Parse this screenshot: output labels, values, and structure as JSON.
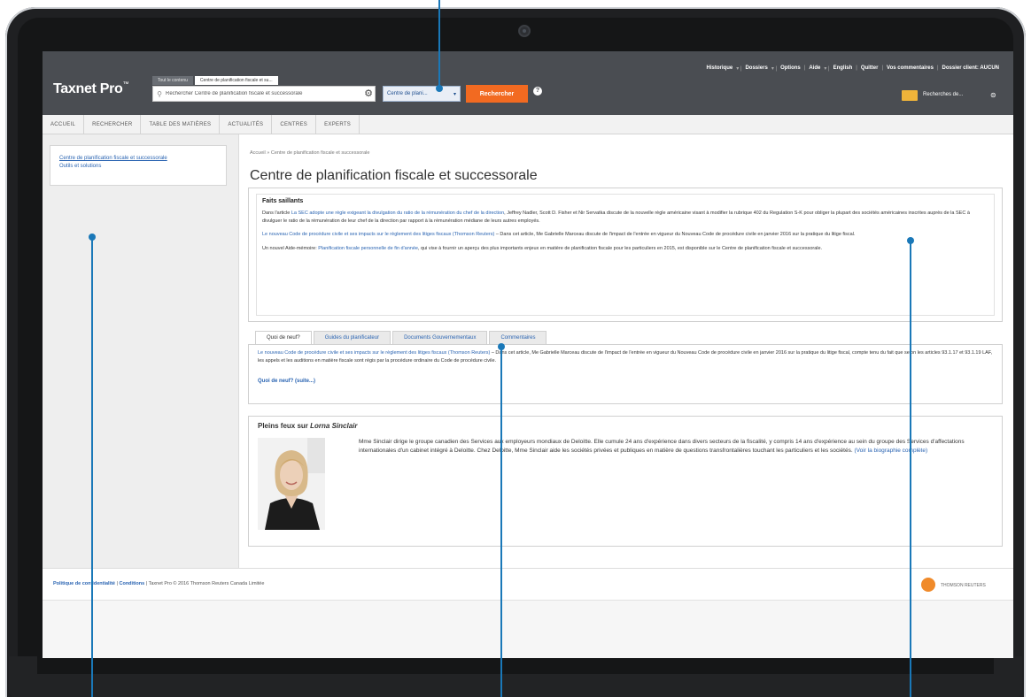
{
  "header": {
    "logo": "Taxnet Pro",
    "logo_tm": "™",
    "scope_tabs": [
      "Tout le contenu",
      "Centre de planification fiscale et su..."
    ],
    "search_placeholder": "Rechercher Centre de planification fiscale et successorale",
    "scope_select": "Centre de plani...",
    "search_button": "Rechercher",
    "help": "?",
    "top_nav": [
      "Historique",
      "Dossiers",
      "Options",
      "Aide",
      "English",
      "Quitter",
      "Vos commentaires",
      "Dossier client: AUCUN"
    ],
    "folder_label": "Recherches de..."
  },
  "main_nav": [
    "ACCUEIL",
    "RECHERCHER",
    "TABLE DES MATIÈRES",
    "ACTUALITÉS",
    "CENTRES",
    "EXPERTS"
  ],
  "sidebar": {
    "items": [
      {
        "label": "Centre de planification fiscale et successorale"
      },
      {
        "label": "Outils et solutions"
      }
    ]
  },
  "content": {
    "breadcrumb": "Accueil » Centre de planification fiscale et successorale",
    "page_title": "Centre de planification fiscale et successorale",
    "highlights": {
      "title": "Faits saillants",
      "p1_pre": "Dans l'article ",
      "p1_link": "La SEC adopte une règle exigeant la divulgation du ratio de la rémunération du chef de la direction",
      "p1_post": ", Jeffrey Nadler, Scott D. Fisher et Nir Servatka discute de la nouvelle règle américaine visant à modifier la rubrique 402 du Regulation S-K pour obliger la plupart des sociétés américaines inscrites auprès de la SEC à divulguer le ratio de la rémunération de leur chef de la direction par rapport à la rémunération médiane de leurs autres employés.",
      "p2_link": "Le nouveau Code de procédure civile et ses impacts sur le règlement des litiges fiscaux (Thomson Reuters)",
      "p2_post": " – Dans cet article, Me Gabrielle Marceau discute de l'impact de l'entrée en vigueur du Nouveau Code de procédure civile en janvier 2016 sur la pratique du litige fiscal.",
      "p3_pre": "Un nouvel Aide-mémoire: ",
      "p3_link": "Planification fiscale personnelle de fin d'année",
      "p3_post": ", qui vise à fournir un aperçu des plus importants enjeux en matière de planification fiscale pour les particuliers en 2015, est disponible sur le Centre de planification fiscale et successorale."
    },
    "tabs": [
      "Quoi de neuf?",
      "Guides du planificateur",
      "Documents Gouvernementaux",
      "Commentaires"
    ],
    "tab_body": {
      "link": "Le nouveau Code de procédure civile et ses impacts sur le règlement des litiges fiscaux (Thomson Reuters)",
      "text": " – Dans cet article, Me Gabrielle Marceau discute de l'impact de l'entrée en vigueur du Nouveau Code de procédure civile en janvier 2016 sur la pratique du litige fiscal, compte tenu du fait que selon les articles 93.1.17 et 93.1.19 LAF, les appels et les auditions en matière fiscale sont régis par la procédure ordinaire du Code de procédure civile.",
      "more": "Quoi de neuf? (suite...)"
    },
    "spotlight": {
      "title_pre": "Pleins feux sur ",
      "title_name": "Lorna Sinclair",
      "text": "Mme Sinclair dirige le groupe canadien des Services aux employeurs mondiaux de Deloitte. Elle cumule 24 ans d'expérience dans divers secteurs de la fiscalité, y compris 14 ans d'expérience au sein du groupe des Services d'affectations internationales d'un cabinet intégré à Deloitte. Chez Deloitte, Mme Sinclair aide les sociétés privées et publiques en matière de questions transfrontalières touchant les particuliers et les sociétés. ",
      "link": "(Voir la biographie complète)"
    }
  },
  "footer": {
    "privacy": "Politique de confidentialité",
    "conditions": "Conditions",
    "copyright": "Taxnet Pro © 2016 Thomson Reuters Canada Limitée",
    "brand": "THOMSON REUTERS"
  },
  "colors": {
    "header_bg": "#4a4d52",
    "accent_orange": "#f26a21",
    "link_blue": "#2a64b2",
    "callout_blue": "#1a78b8"
  }
}
